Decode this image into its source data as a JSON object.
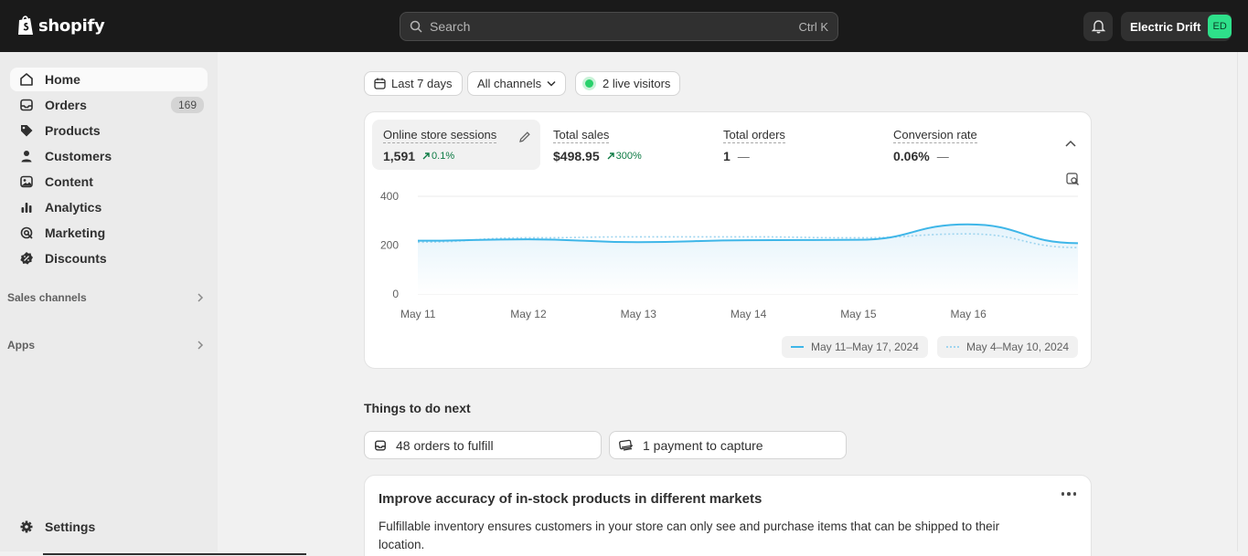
{
  "topbar": {
    "brand": "shopify",
    "search_placeholder": "Search",
    "search_shortcut": "Ctrl K",
    "store_name": "Electric Drift",
    "store_initials": "ED"
  },
  "sidebar": {
    "items": [
      {
        "label": "Home",
        "icon": "home-icon",
        "active": true
      },
      {
        "label": "Orders",
        "icon": "inbox-icon",
        "count": "169"
      },
      {
        "label": "Products",
        "icon": "tag-icon"
      },
      {
        "label": "Customers",
        "icon": "person-icon"
      },
      {
        "label": "Content",
        "icon": "image-icon"
      },
      {
        "label": "Analytics",
        "icon": "bar-chart-icon"
      },
      {
        "label": "Marketing",
        "icon": "target-icon"
      },
      {
        "label": "Discounts",
        "icon": "discount-icon"
      }
    ],
    "sections": [
      "Sales channels",
      "Apps"
    ],
    "settings_label": "Settings"
  },
  "filters": {
    "date_range": "Last 7 days",
    "channels": "All channels",
    "live_visitors": "2 live visitors"
  },
  "metrics": [
    {
      "label": "Online store sessions",
      "value": "1,591",
      "delta": "0.1%"
    },
    {
      "label": "Total sales",
      "value": "$498.95",
      "delta": "300%"
    },
    {
      "label": "Total orders",
      "value": "1",
      "delta": "—"
    },
    {
      "label": "Conversion rate",
      "value": "0.06%",
      "delta": "—"
    }
  ],
  "chart_data": {
    "type": "line",
    "x": [
      "May 11",
      "May 12",
      "May 13",
      "May 14",
      "May 15",
      "May 16",
      "May 17"
    ],
    "tick_labels": [
      "May 11",
      "May 12",
      "May 13",
      "May 14",
      "May 15",
      "May 16"
    ],
    "y_ticks": [
      "400",
      "200",
      "0"
    ],
    "ylim": [
      0,
      400
    ],
    "series": [
      {
        "name": "May 11–May 17, 2024",
        "style": "solid",
        "color": "#3eb6e8",
        "values": [
          218,
          224,
          212,
          220,
          222,
          285,
          208
        ]
      },
      {
        "name": "May 4–May 10, 2024",
        "style": "dotted",
        "color": "#9fd5ef",
        "values": [
          212,
          230,
          234,
          234,
          230,
          246,
          190
        ]
      }
    ]
  },
  "things": {
    "title": "Things to do next",
    "tasks": [
      "48 orders to fulfill",
      "1 payment to capture"
    ]
  },
  "tip": {
    "title": "Improve accuracy of in-stock products in different markets",
    "body": "Fulfillable inventory ensures customers in your store can only see and purchase items that can be shipped to their location."
  },
  "colors": {
    "topbar": "#1a1a1a",
    "accent_line": "#3eb6e8",
    "positive": "#0c7a43",
    "live_dot": "#29d16b"
  }
}
